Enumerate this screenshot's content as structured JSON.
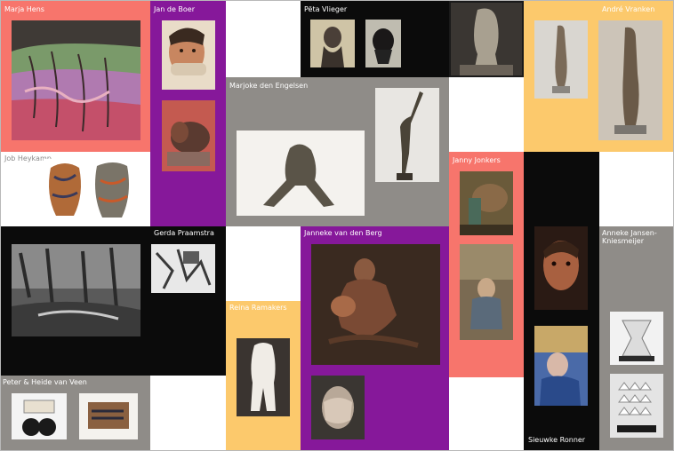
{
  "colors": {
    "salmon": "#f7756c",
    "purple": "#86189a",
    "black": "#0b0b0b",
    "gray": "#8f8c88",
    "yellow": "#fcc96c",
    "white": "#ffffff"
  },
  "artists": {
    "marja_hens": "Marja Hens",
    "jan_de_boer": "Jan de Boer",
    "peta_vlieger": "Pëta Vlieger",
    "andre_vranken": "André Vranken",
    "marjoke_den_engelsen": "Marjoke den Engelsen",
    "job_heykamp": "Job Heykamp",
    "janny_jonkers": "Janny Jonkers",
    "gerda_praamstra": "Gerda Praamstra",
    "janneke_van_den_berg": "Janneke van den Berg",
    "anneke_jansen_kniesmeijer": "Anneke Jansen-Kniesmeijer",
    "reina_ramakers": "Reina Ramakers",
    "peter_heide_van_veen": "Peter & Heide van Veen",
    "sieuwke_ronner": "Sieuwke Ronner"
  }
}
